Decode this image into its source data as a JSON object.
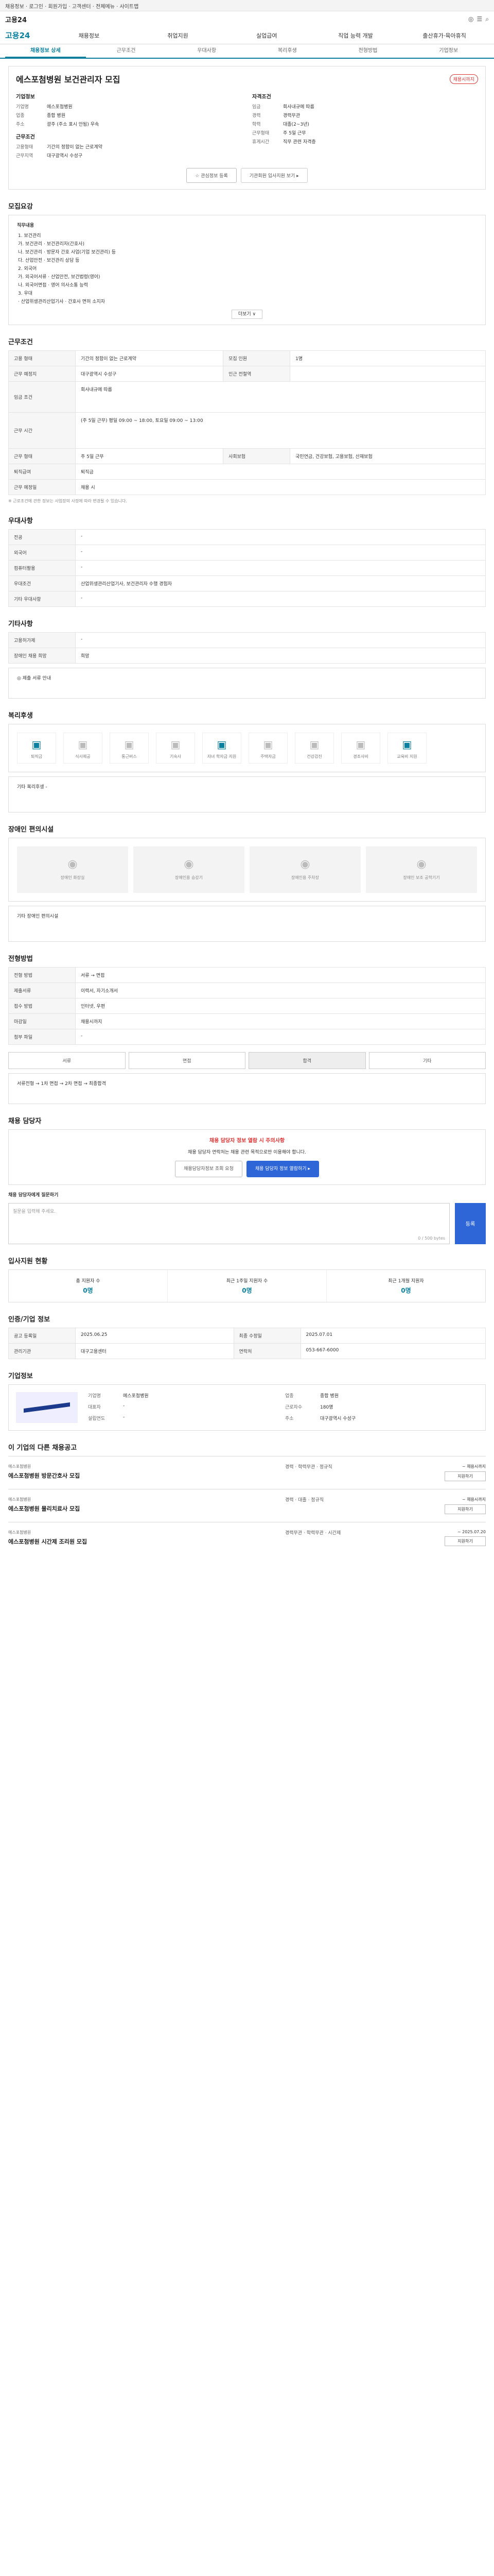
{
  "topbar": {
    "text": "채용정보 · 로그인 · 회원가입 · 고객센터 · 전체메뉴 · 사이트맵"
  },
  "header": {
    "logo": "고용24",
    "icons": [
      "◎",
      "☰",
      "⌕"
    ]
  },
  "gnb": {
    "home": "고용24",
    "items": [
      "채용정보",
      "취업지원",
      "실업급여",
      "직업 능력 개발",
      "출산휴가·육아휴직"
    ]
  },
  "tabs": [
    "채용정보 상세",
    "근무조건",
    "우대사항",
    "복리후생",
    "전형방법",
    "기업정보"
  ],
  "job": {
    "title": "에스포첨병원 보건관리자 모집",
    "badge": "채용시까지",
    "company_head": "기업정보",
    "company": [
      [
        "기업명",
        "에스포첨병원"
      ],
      [
        "업종",
        "종합 병원"
      ],
      [
        "주소",
        "광주 (주소 표시 안됨) 우속",
        ""
      ]
    ],
    "cond_head": "근무조건",
    "cond": [
      [
        "고용형태",
        "기간의 정함이 없는 근로계약"
      ],
      [
        "근무지역",
        "대구광역시 수성구"
      ],
      [
        "임금",
        "회사내규에 따름"
      ],
      [
        "경력",
        "경력무관"
      ],
      [
        "학력",
        "대졸(2~3년)"
      ]
    ],
    "extra_head": "자격조건",
    "extra": [
      [
        "근무형태",
        "주 5일 근무"
      ],
      [
        "휴게시간",
        "직무 관련 자격증"
      ]
    ],
    "btn_scrap": "☆ 관심정보 등록",
    "btn_print": "기관회원 입사지원 보기 ▸"
  },
  "summary": {
    "head": "모집요강",
    "title": "직무내용",
    "lines": [
      "1. 보건관리",
      "가. 보건관리 · 보건관리자(간호사)",
      "나. 보건관리 · 방문자 간호 사업(기업 보건관리) 등",
      "다. 산업안전 · 보건관리 상담 등",
      "2. 외국어",
      "가. 외국어서류 · 산업안전, 보건법령(영어)",
      "나. 외국어면접 · 영어 의사소통 능력",
      "3. 우대",
      "· 산업위생관리산업기사 · 간호사 면허 소지자"
    ],
    "more": "더보기 ∨"
  },
  "work": {
    "head": "근무조건",
    "rows": [
      [
        "고용 형태",
        "기간의 정함이 없는 근로계약",
        "모집 인원",
        "1명"
      ],
      [
        "근무 예정지",
        "대구광역시 수성구 ",
        "인근 전철역",
        ""
      ],
      [
        "임금 조건",
        "회사내규에 따름",
        "",
        ""
      ],
      [
        "근무 시간",
        "(주 5일 근무) 평일 09:00 ~ 18:00, 토요일 09:00 ~ 13:00",
        "",
        ""
      ],
      [
        "근무 형태",
        "주 5일 근무",
        "사회보험",
        "국민연금, 건강보험, 고용보험, 산재보험"
      ],
      [
        "퇴직급여",
        "퇴직금",
        "",
        ""
      ],
      [
        "근무 예정일",
        "채용 시",
        "",
        ""
      ]
    ],
    "note": "※ 근로조건에 관한 정보는 사업장의 사정에 따라 변경될 수 있습니다."
  },
  "pref": {
    "head": "우대사항",
    "rows": [
      [
        "전공",
        "-"
      ],
      [
        "외국어",
        "-"
      ],
      [
        "컴퓨터활용",
        "-"
      ],
      [
        "우대조건",
        "산업위생관리산업기사, 보건관리자 수행 경험자"
      ],
      [
        "기타 우대사항",
        "-"
      ]
    ]
  },
  "etc": {
    "head": "기타사항",
    "rows": [
      [
        "고용허가제",
        "-"
      ],
      [
        "장애인 채용 희망",
        "희망"
      ]
    ],
    "note": "◎ 제출 서류 안내"
  },
  "welfare": {
    "head": "복리후생",
    "items": [
      "퇴직금",
      "식사제공",
      "통근버스",
      "기숙사",
      "자녀 학자금 지원",
      "주택자금",
      "건강검진",
      "경조사비",
      "교육비 지원"
    ],
    "extra_label": "기타 복리후생",
    "extra": "-"
  },
  "disabled": {
    "head": "장애인 편의시설",
    "items": [
      "장애인 화장실",
      "장애인용 승강기",
      "장애인용 주차장",
      "장애인 보조 공학기기"
    ],
    "note": "기타 장애인 편의시설"
  },
  "process": {
    "head": "전형방법",
    "rows": [
      [
        "전형 방법",
        "서류 → 면접"
      ],
      [
        "제출서류",
        "이력서, 자기소개서"
      ],
      [
        "접수 방법",
        "인터넷, 우편"
      ],
      [
        "마감일",
        "채용시까지"
      ],
      [
        "첨부 파일",
        "-"
      ]
    ],
    "tabs": [
      "서류",
      "면접",
      "합격",
      "기타"
    ],
    "flow": "서류전형 → 1차 면접 → 2차 면접 → 최종합격"
  },
  "contact": {
    "head": "채용 담당자",
    "alert_title": "채용 담당자 정보 열람 시 주의사항",
    "alert_text": "채용 담당자 연락처는 채용 관련 목적으로만 이용해야 합니다.",
    "btn1": "채용담당자정보 조회 요청",
    "btn2": "채용 담당자 정보 열람하기 ▸",
    "apply_label": "채용 담당자에게 질문하기",
    "placeholder": "질문을 입력해 주세요.",
    "count": "0 / 500 bytes",
    "go": "등록"
  },
  "stats": {
    "head": "입사지원 현황",
    "items": [
      [
        "총 지원자 수",
        "0명"
      ],
      [
        "최근 1주일 지원자 수",
        "0명"
      ],
      [
        "최근 1개월 지원자",
        "0명"
      ]
    ]
  },
  "history": {
    "head": "인증/기업 정보",
    "rows": [
      [
        "공고 등록일",
        "2025.06.25",
        "최종 수정일",
        "2025.07.01"
      ],
      [
        "관리기관",
        "대구고용센터",
        "연락처",
        "053-667-6000"
      ]
    ]
  },
  "company": {
    "head": "기업정보",
    "rows": [
      [
        "기업명",
        "에스포첨병원",
        "업종",
        "종합 병원"
      ],
      [
        "대표자",
        "-",
        "근로자수",
        "180명"
      ],
      [
        "설립연도",
        "-",
        "주소",
        "대구광역시 수성구"
      ]
    ]
  },
  "related": {
    "head": "이 기업의 다른 채용공고",
    "jobs": [
      {
        "nm": "에스포첨병원",
        "title": "에스포첨병원 방문간호사 모집",
        "info": "경력 · 학력무관 · 정규직",
        "date": "~ 채용시까지",
        "btn": "지원하기"
      },
      {
        "nm": "에스포첨병원",
        "title": "에스포첨병원 물리치료사 모집",
        "info": "경력 · 대졸 · 정규직",
        "date": "~ 채용시까지",
        "btn": "지원하기"
      },
      {
        "nm": "에스포첨병원",
        "title": "에스포첨병원 시간제 조리원 모집",
        "info": "경력무관 · 학력무관 · 시간제",
        "date": "~ 2025.07.20",
        "btn": "지원하기"
      }
    ]
  },
  "colors": {
    "accent": "#0a7f9e",
    "blue": "#2e66d8",
    "red": "#d33"
  }
}
